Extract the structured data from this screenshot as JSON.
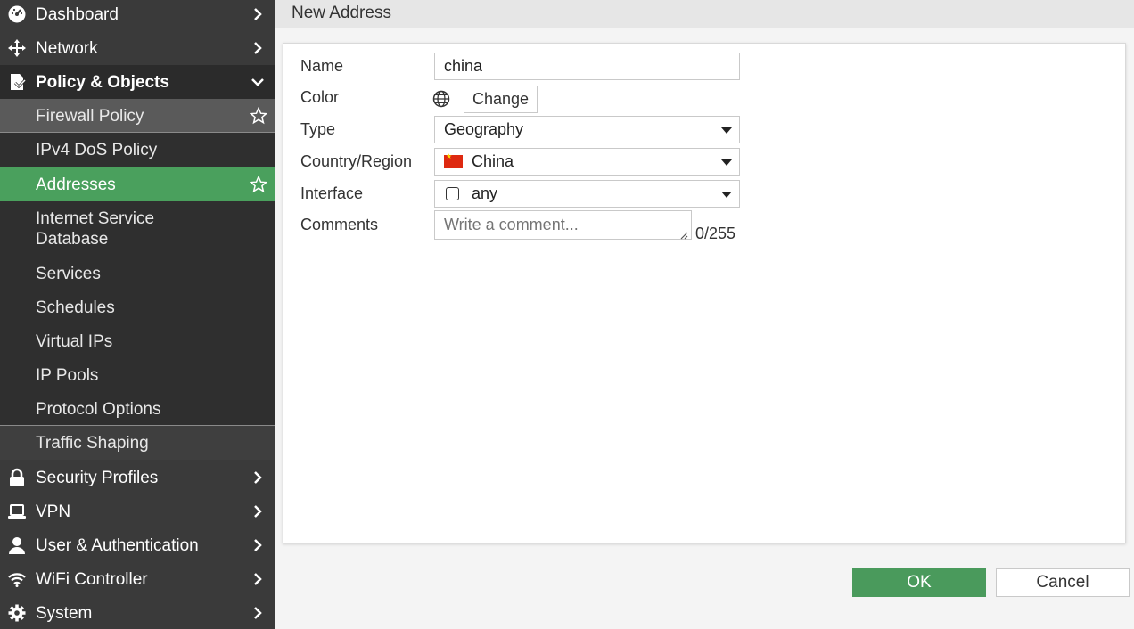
{
  "sidebar": {
    "dashboard": "Dashboard",
    "network": "Network",
    "policy_objects": "Policy & Objects",
    "firewall_policy": "Firewall Policy",
    "ipv4_dos_policy": "IPv4 DoS Policy",
    "addresses": "Addresses",
    "internet_service_database": "Internet Service Database",
    "services": "Services",
    "schedules": "Schedules",
    "virtual_ips": "Virtual IPs",
    "ip_pools": "IP Pools",
    "protocol_options": "Protocol Options",
    "traffic_shaping": "Traffic Shaping",
    "security_profiles": "Security Profiles",
    "vpn": "VPN",
    "user_authentication": "User & Authentication",
    "wifi_controller": "WiFi Controller",
    "system": "System"
  },
  "header": {
    "title": "New Address"
  },
  "form": {
    "name_label": "Name",
    "name_value": "china",
    "color_label": "Color",
    "change_button": "Change",
    "type_label": "Type",
    "type_value": "Geography",
    "country_label": "Country/Region",
    "country_value": "China",
    "interface_label": "Interface",
    "interface_value": "any",
    "comments_label": "Comments",
    "comments_placeholder": "Write a comment...",
    "comments_counter": "0/255"
  },
  "footer": {
    "ok": "OK",
    "cancel": "Cancel"
  },
  "colors": {
    "accent": "#4aa05d",
    "sidebar": "#3a3a3a"
  }
}
